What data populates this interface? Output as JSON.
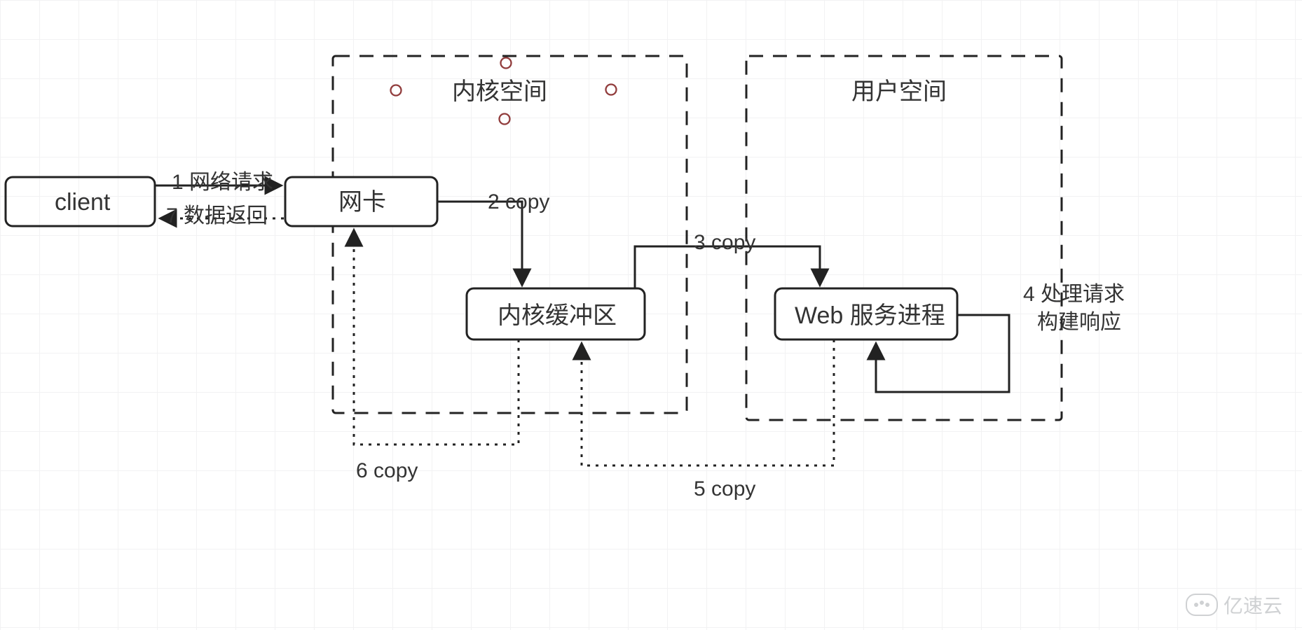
{
  "chart_data": {
    "type": "diagram",
    "groups": [
      {
        "id": "kernel_space",
        "label": "内核空间",
        "contains": [
          "nic",
          "kernel_buffer"
        ],
        "style": "dashed"
      },
      {
        "id": "user_space",
        "label": "用户空间",
        "contains": [
          "web_process"
        ],
        "style": "dashed"
      }
    ],
    "nodes": [
      {
        "id": "client",
        "label": "client"
      },
      {
        "id": "nic",
        "label": "网卡"
      },
      {
        "id": "kernel_buffer",
        "label": "内核缓冲区"
      },
      {
        "id": "web_process",
        "label": "Web 服务进程"
      }
    ],
    "edges": [
      {
        "from": "client",
        "to": "nic",
        "seq": 1,
        "label": "1 网络请求",
        "style": "solid"
      },
      {
        "from": "nic",
        "to": "kernel_buffer",
        "seq": 2,
        "label": "2 copy",
        "style": "solid"
      },
      {
        "from": "kernel_buffer",
        "to": "web_process",
        "seq": 3,
        "label": "3 copy",
        "style": "solid"
      },
      {
        "from": "web_process",
        "to": "web_process",
        "seq": 4,
        "label": "4 处理请求 构建响应",
        "style": "solid_loop"
      },
      {
        "from": "web_process",
        "to": "kernel_buffer",
        "seq": 5,
        "label": "5 copy",
        "style": "dotted"
      },
      {
        "from": "kernel_buffer",
        "to": "nic",
        "seq": 6,
        "label": "6 copy",
        "style": "dotted"
      },
      {
        "from": "nic",
        "to": "client",
        "seq": 7,
        "label": "7 数据返回",
        "style": "dotted"
      }
    ]
  },
  "labels": {
    "kernel_space": "内核空间",
    "user_space": "用户空间",
    "client": "client",
    "nic": "网卡",
    "kernel_buffer": "内核缓冲区",
    "web_process": "Web 服务进程",
    "e1": "1 网络请求",
    "e2": "2 copy",
    "e3": "3 copy",
    "e4a": "4 处理请求",
    "e4b": "构建响应",
    "e5": "5 copy",
    "e6": "6 copy",
    "e7": "7 数据返回"
  },
  "watermark": "亿速云",
  "colors": {
    "stroke": "#222",
    "circle": "#913c3c",
    "grid": "#e8e8ea",
    "watermark": "#c7c9cc"
  }
}
